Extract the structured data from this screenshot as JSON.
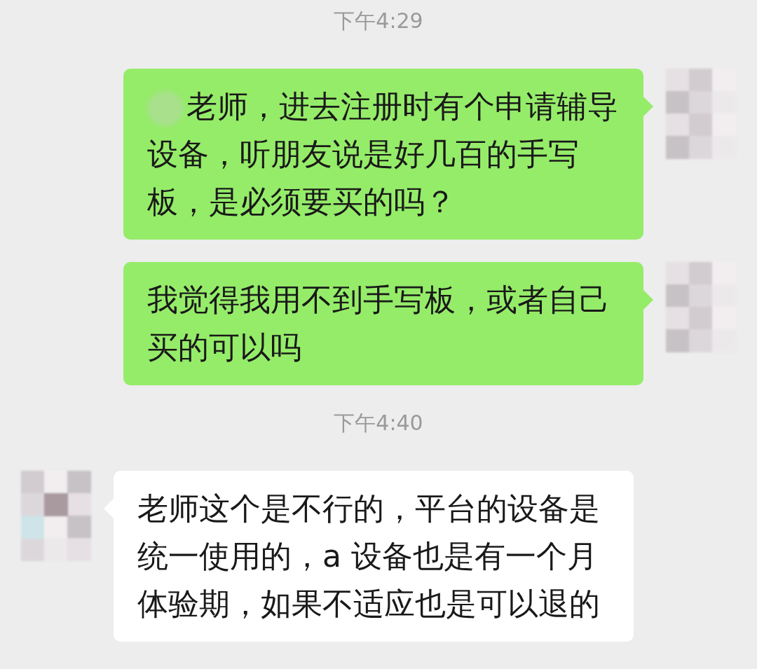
{
  "chat": [
    {
      "kind": "time",
      "text": "下午4:29"
    },
    {
      "kind": "outgoing",
      "redacted_prefix": true,
      "text": "老师，进去注册时有个申请辅导设备，听朋友说是好几百的手写板，是必须要买的吗？"
    },
    {
      "kind": "outgoing",
      "redacted_prefix": false,
      "text": "我觉得我用不到手写板，或者自己买的可以吗"
    },
    {
      "kind": "time",
      "text": "下午4:40"
    },
    {
      "kind": "incoming",
      "redacted_prefix": false,
      "text": "老师这个是不行的，平台的设备是统一使用的，a 设备也是有一个月体验期，如果不适应也是可以退的"
    }
  ]
}
